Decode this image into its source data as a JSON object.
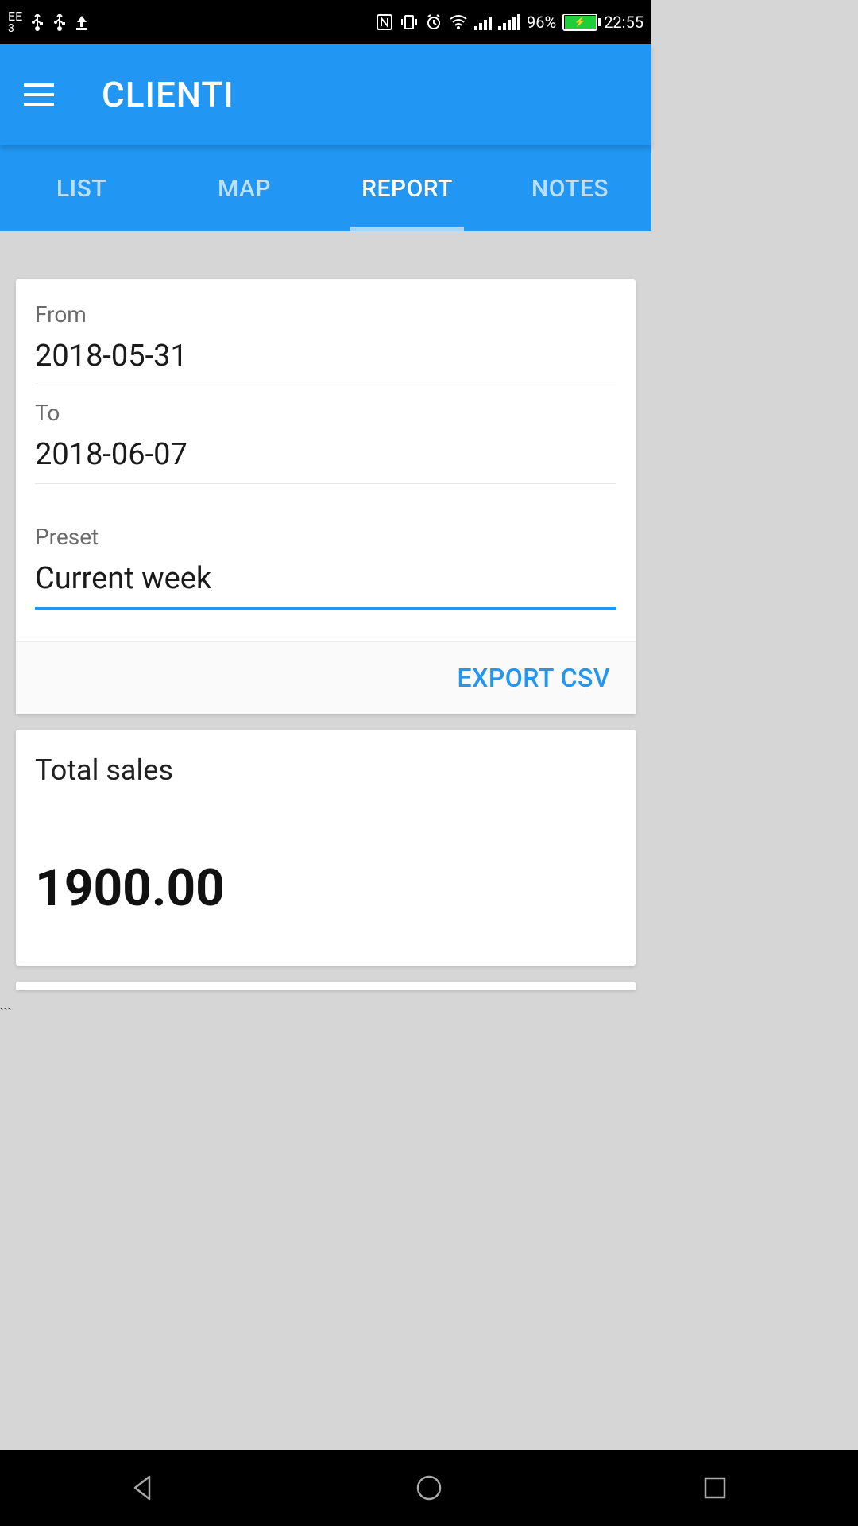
{
  "status": {
    "carrier": "EE",
    "carrier_sub": "3",
    "battery_percent": "96%",
    "time": "22:55"
  },
  "header": {
    "title": "CLIENTI"
  },
  "tabs": [
    {
      "label": "LIST",
      "active": false
    },
    {
      "label": "MAP",
      "active": false
    },
    {
      "label": "REPORT",
      "active": true
    },
    {
      "label": "NOTES",
      "active": false
    }
  ],
  "report": {
    "from_label": "From",
    "from_value": "2018-05-31",
    "to_label": "To",
    "to_value": "2018-06-07",
    "preset_label": "Preset",
    "preset_value": "Current week",
    "export_label": "EXPORT CSV"
  },
  "summary": {
    "label": "Total sales",
    "value": "1900.00"
  }
}
